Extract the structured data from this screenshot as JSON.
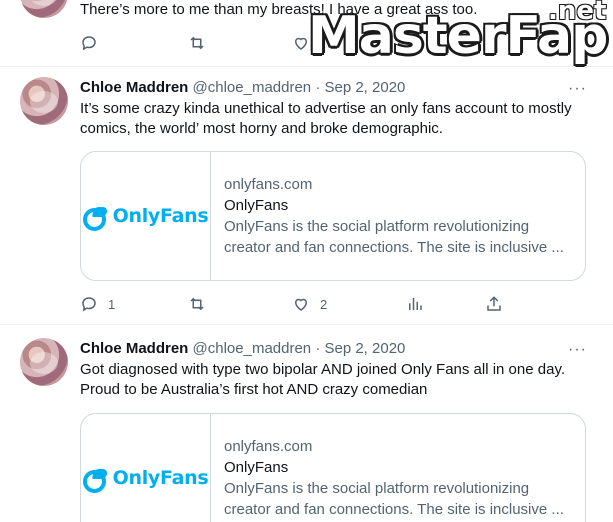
{
  "tweets": [
    {
      "body": "There’s more to me than my breasts! I have a great ass too."
    },
    {
      "name": "Chloe Maddren",
      "meta": "@chloe_maddren · Sep 2, 2020",
      "body": "It’s some crazy kinda unethical to advertise an only fans account to mostly comics, the world’ most horny and broke demographic.",
      "card": {
        "logo": "OnlyFans",
        "domain": "onlyfans.com",
        "title": "OnlyFans",
        "desc_line1": "OnlyFans is the social platform revolutionizing",
        "desc_line2": "creator and fan connections. The site is inclusive ..."
      },
      "replies": "1",
      "likes": "2"
    },
    {
      "name": "Chloe Maddren",
      "meta": "@chloe_maddren · Sep 2, 2020",
      "body": "Got diagnosed with type two bipolar AND joined Only Fans all in one day. Proud to be Australia’s first hot AND crazy comedian",
      "card": {
        "logo": "OnlyFans",
        "domain": "onlyfans.com",
        "title": "OnlyFans",
        "desc_line1": "OnlyFans is the social platform revolutionizing",
        "desc_line2": "creator and fan connections. The site is inclusive ..."
      }
    }
  ],
  "more_glyph": "···",
  "watermark": {
    "text": "MasterFap",
    "suffix": ".net"
  },
  "colors": {
    "accent": "#00aff0",
    "muted": "#536471",
    "border": "#cfd9de"
  }
}
